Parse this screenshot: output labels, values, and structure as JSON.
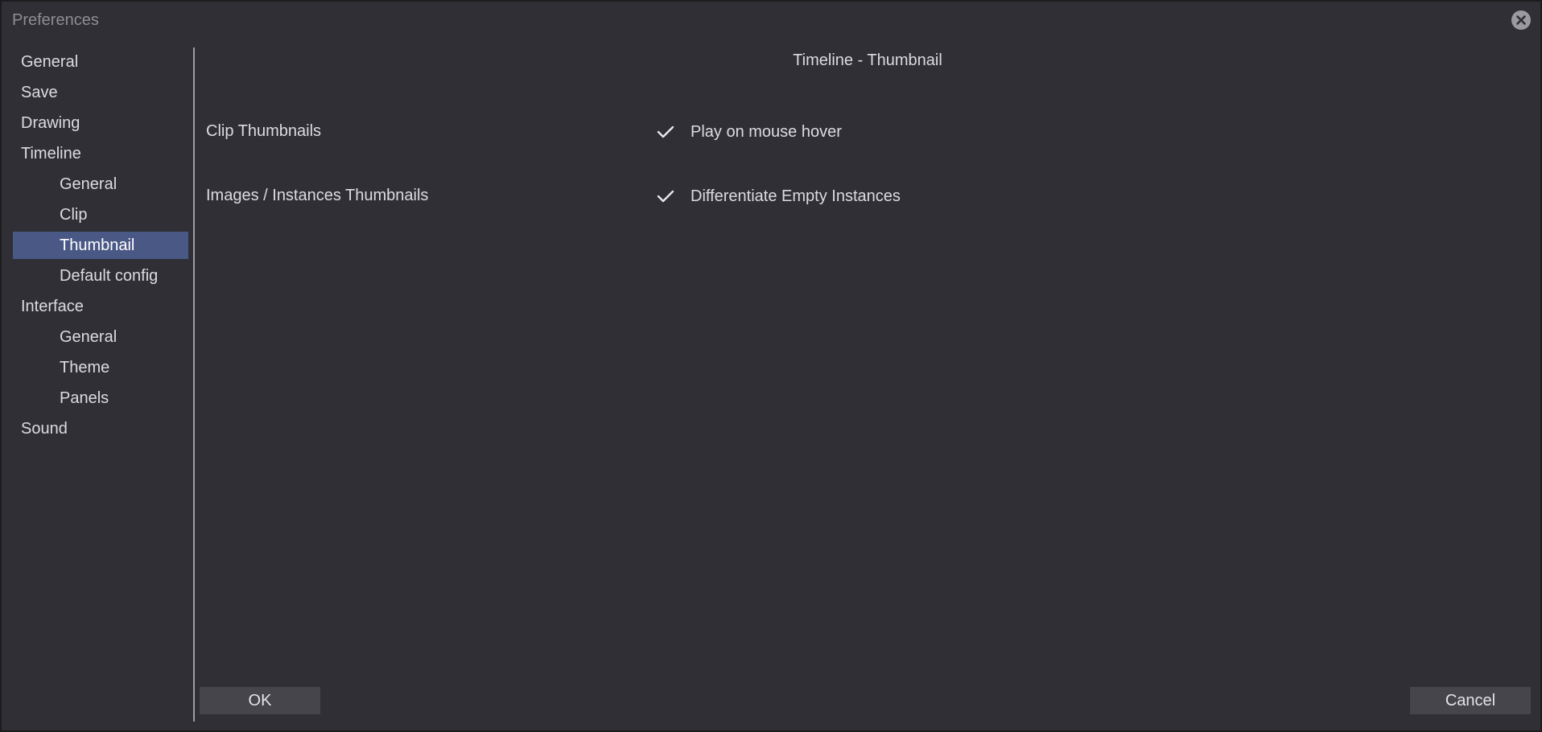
{
  "window": {
    "title": "Preferences"
  },
  "sidebar": {
    "items": [
      {
        "label": "General"
      },
      {
        "label": "Save"
      },
      {
        "label": "Drawing"
      },
      {
        "label": "Timeline"
      },
      {
        "label": "General"
      },
      {
        "label": "Clip"
      },
      {
        "label": "Thumbnail",
        "selected": true
      },
      {
        "label": "Default config"
      },
      {
        "label": "Interface"
      },
      {
        "label": "General"
      },
      {
        "label": "Theme"
      },
      {
        "label": "Panels"
      },
      {
        "label": "Sound"
      }
    ]
  },
  "main": {
    "page_title": "Timeline - Thumbnail",
    "rows": [
      {
        "label": "Clip Thumbnails",
        "option": {
          "label": "Play on mouse hover",
          "checked": true
        }
      },
      {
        "label": "Images / Instances Thumbnails",
        "option": {
          "label": "Differentiate Empty Instances",
          "checked": true
        }
      }
    ]
  },
  "footer": {
    "ok_label": "OK",
    "cancel_label": "Cancel"
  },
  "colors": {
    "background": "#2f2f35",
    "selection": "#4a5886",
    "button": "#45454b",
    "text": "#dcdce0"
  },
  "icons": {
    "close": "close-circle-icon",
    "check": "checkmark-icon"
  }
}
